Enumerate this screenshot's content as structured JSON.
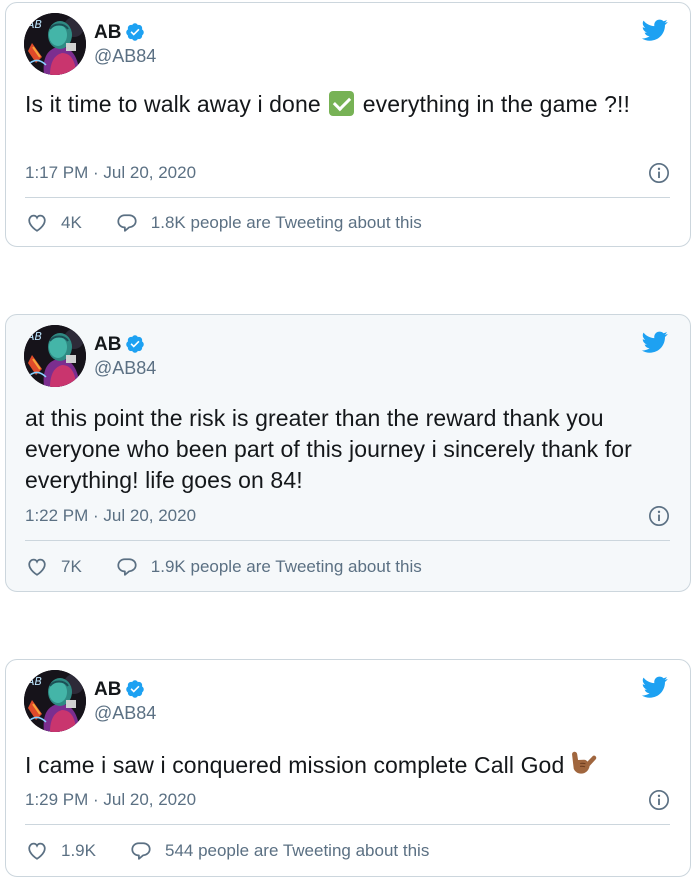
{
  "tweets": [
    {
      "name": "AB",
      "handle": "@AB84",
      "text_before": "Is it time to walk away i done ",
      "emoji": "check-mark-button",
      "text_after": " everything in the game ?!!",
      "timestamp": "1:17 PM · Jul 20, 2020",
      "likes": "4K",
      "tweeting": "1.8K people are Tweeting about this"
    },
    {
      "name": "AB",
      "handle": "@AB84",
      "text": "at this point the risk is greater than the reward thank you everyone who been part of this journey i sincerely thank for everything! life goes on 84!",
      "timestamp": "1:22 PM · Jul 20, 2020",
      "likes": "7K",
      "tweeting": "1.9K people are Tweeting about this"
    },
    {
      "name": "AB",
      "handle": "@AB84",
      "text": "I came i saw i conquered mission complete Call God",
      "emoji": "call-me-hand",
      "timestamp": "1:29 PM · Jul 20, 2020",
      "likes": "1.9K",
      "tweeting": "544 people are Tweeting about this"
    }
  ],
  "colors": {
    "twitter_blue": "#1da1f2",
    "text_primary": "#14171a",
    "text_secondary": "#5b7083",
    "border": "#ccd6dd",
    "highlight_bg": "#f5f8fa"
  },
  "icons": [
    "twitter-bird-icon",
    "verified-badge-icon",
    "info-icon",
    "heart-icon",
    "reply-bubble-icon"
  ]
}
